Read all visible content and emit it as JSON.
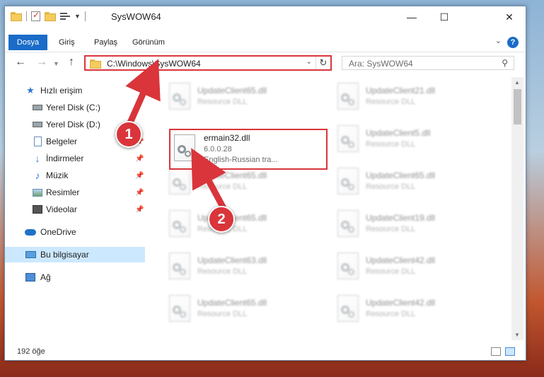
{
  "window": {
    "title": "SysWOW64"
  },
  "ribbon": {
    "tabs": [
      "Dosya",
      "Giriş",
      "Paylaş",
      "Görünüm"
    ]
  },
  "address": {
    "path": "C:\\Windows\\SysWOW64"
  },
  "search": {
    "placeholder": "Ara: SysWOW64"
  },
  "sidebar": {
    "quick_access": "Hızlı erişim",
    "items": [
      {
        "label": "Yerel Disk (C:)",
        "icon": "drive-icon"
      },
      {
        "label": "Yerel Disk (D:)",
        "icon": "drive-icon"
      },
      {
        "label": "Belgeler",
        "icon": "documents-icon"
      },
      {
        "label": "İndirmeler",
        "icon": "download-icon"
      },
      {
        "label": "Müzik",
        "icon": "music-icon"
      },
      {
        "label": "Resimler",
        "icon": "pictures-icon"
      },
      {
        "label": "Videolar",
        "icon": "videos-icon"
      }
    ],
    "onedrive": "OneDrive",
    "this_pc": "Bu bilgisayar",
    "network": "Ağ"
  },
  "files": {
    "left_column": [
      {
        "name": "UpdateClient65.dll",
        "desc": "Resource DLL"
      },
      {
        "name": "UpdateClient65.dll",
        "desc": "Resource DLL"
      },
      {
        "name": "UpdateClient65.dll",
        "desc": "Resource DLL"
      },
      {
        "name": "UpdateClient63.dll",
        "desc": "Resource DLL"
      },
      {
        "name": "UpdateClient65.dll",
        "desc": "Resource DLL"
      }
    ],
    "right_column": [
      {
        "name": "UpdateClient21.dll",
        "desc": "Resource DLL"
      },
      {
        "name": "UpdateClient5.dll",
        "desc": "Resource DLL"
      },
      {
        "name": "UpdateClient65.dll",
        "desc": "Resource DLL"
      },
      {
        "name": "UpdateClient19.dll",
        "desc": "Resource DLL"
      },
      {
        "name": "UpdateClient42.dll",
        "desc": "Resource DLL"
      },
      {
        "name": "UpdateClient42.dll",
        "desc": "Resource DLL"
      }
    ],
    "highlighted": {
      "name": "ermain32.dll",
      "version": "6.0.0.28",
      "desc": "English-Russian tra..."
    }
  },
  "status": {
    "count": "192 öğe"
  },
  "annotations": {
    "step1": "1",
    "step2": "2",
    "color": "#d9353b"
  }
}
